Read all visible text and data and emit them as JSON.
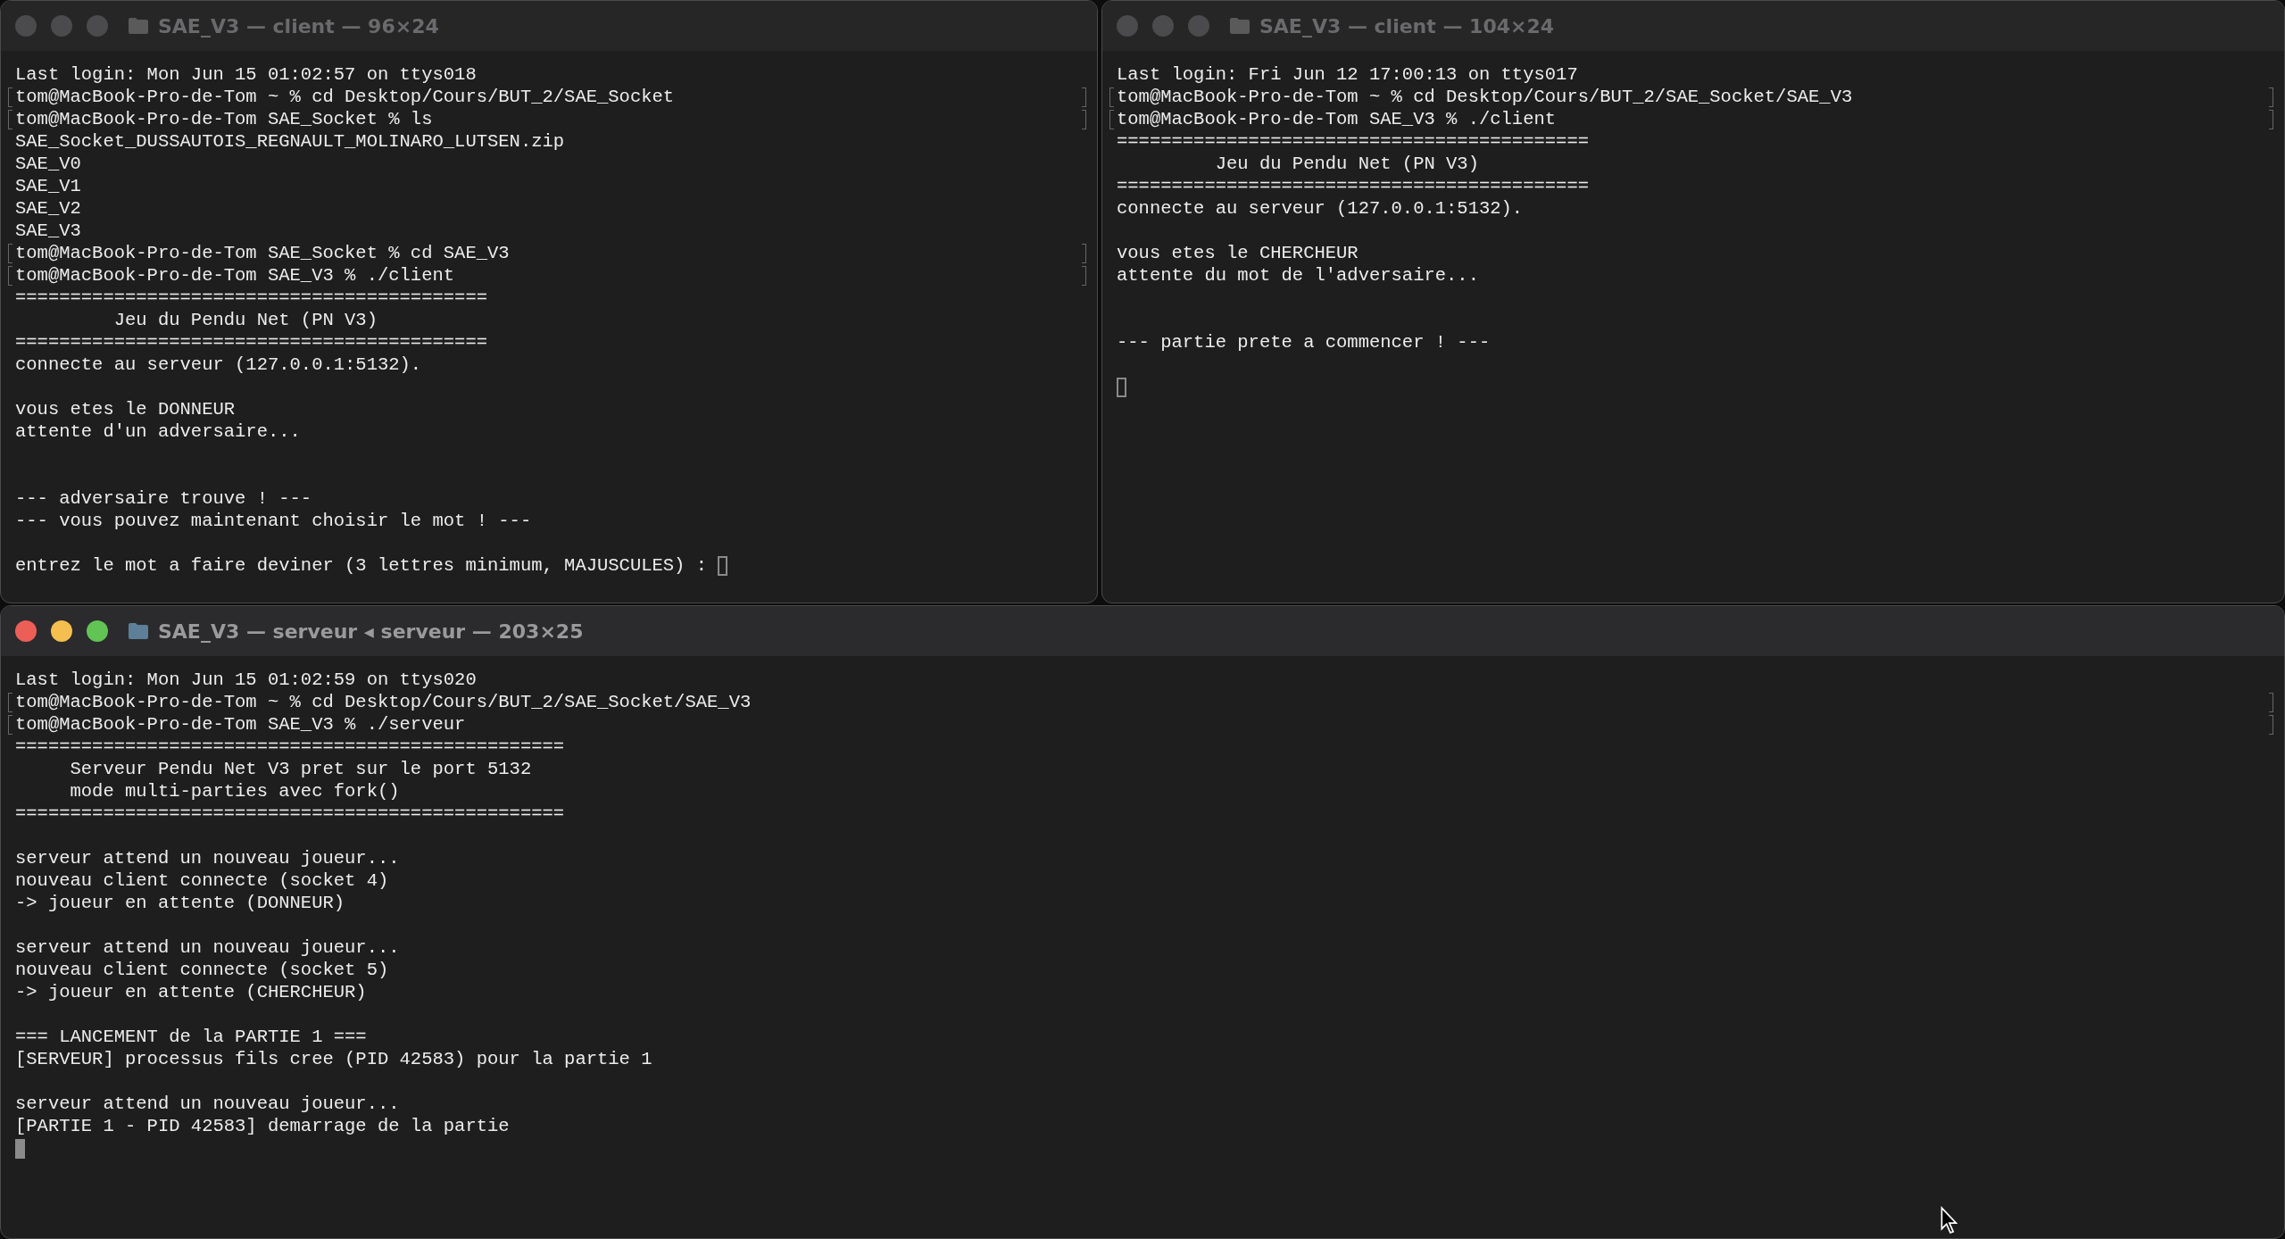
{
  "windows": [
    {
      "title": "SAE_V3 — client — 96×24",
      "focused": false,
      "lines": [
        {
          "kind": "output",
          "text": "Last login: Mon Jun 15 01:02:57 on ttys018"
        },
        {
          "kind": "command",
          "text": "tom@MacBook-Pro-de-Tom ~ % cd Desktop/Cours/BUT_2/SAE_Socket"
        },
        {
          "kind": "command",
          "text": "tom@MacBook-Pro-de-Tom SAE_Socket % ls"
        },
        {
          "kind": "output",
          "text": "SAE_Socket_DUSSAUTOIS_REGNAULT_MOLINARO_LUTSEN.zip"
        },
        {
          "kind": "output",
          "text": "SAE_V0"
        },
        {
          "kind": "output",
          "text": "SAE_V1"
        },
        {
          "kind": "output",
          "text": "SAE_V2"
        },
        {
          "kind": "output",
          "text": "SAE_V3"
        },
        {
          "kind": "command",
          "text": "tom@MacBook-Pro-de-Tom SAE_Socket % cd SAE_V3"
        },
        {
          "kind": "command",
          "text": "tom@MacBook-Pro-de-Tom SAE_V3 % ./client"
        },
        {
          "kind": "output",
          "text": "==========================================="
        },
        {
          "kind": "output",
          "text": "         Jeu du Pendu Net (PN V3)"
        },
        {
          "kind": "output",
          "text": "==========================================="
        },
        {
          "kind": "output",
          "text": "connecte au serveur (127.0.0.1:5132)."
        },
        {
          "kind": "blank"
        },
        {
          "kind": "output",
          "text": "vous etes le DONNEUR"
        },
        {
          "kind": "output",
          "text": "attente d'un adversaire..."
        },
        {
          "kind": "blank"
        },
        {
          "kind": "blank"
        },
        {
          "kind": "output",
          "text": "--- adversaire trouve ! ---"
        },
        {
          "kind": "output",
          "text": "--- vous pouvez maintenant choisir le mot ! ---"
        },
        {
          "kind": "blank"
        },
        {
          "kind": "input",
          "text": "entrez le mot a faire deviner (3 lettres minimum, MAJUSCULES) : ",
          "cursor_filled": false
        }
      ]
    },
    {
      "title": "SAE_V3 — client — 104×24",
      "focused": false,
      "lines": [
        {
          "kind": "output",
          "text": "Last login: Fri Jun 12 17:00:13 on ttys017"
        },
        {
          "kind": "command",
          "text": "tom@MacBook-Pro-de-Tom ~ % cd Desktop/Cours/BUT_2/SAE_Socket/SAE_V3"
        },
        {
          "kind": "command",
          "text": "tom@MacBook-Pro-de-Tom SAE_V3 % ./client"
        },
        {
          "kind": "output",
          "text": "==========================================="
        },
        {
          "kind": "output",
          "text": "         Jeu du Pendu Net (PN V3)"
        },
        {
          "kind": "output",
          "text": "==========================================="
        },
        {
          "kind": "output",
          "text": "connecte au serveur (127.0.0.1:5132)."
        },
        {
          "kind": "blank"
        },
        {
          "kind": "output",
          "text": "vous etes le CHERCHEUR"
        },
        {
          "kind": "output",
          "text": "attente du mot de l'adversaire..."
        },
        {
          "kind": "blank"
        },
        {
          "kind": "blank"
        },
        {
          "kind": "output",
          "text": "--- partie prete a commencer ! ---"
        },
        {
          "kind": "blank"
        },
        {
          "kind": "input",
          "cursor_filled": false
        }
      ]
    },
    {
      "title": "SAE_V3 — serveur ◂ serveur — 203×25",
      "focused": true,
      "lines": [
        {
          "kind": "output",
          "text": "Last login: Mon Jun 15 01:02:59 on ttys020"
        },
        {
          "kind": "command",
          "text": "tom@MacBook-Pro-de-Tom ~ % cd Desktop/Cours/BUT_2/SAE_Socket/SAE_V3"
        },
        {
          "kind": "command",
          "text": "tom@MacBook-Pro-de-Tom SAE_V3 % ./serveur"
        },
        {
          "kind": "output",
          "text": "=================================================="
        },
        {
          "kind": "output",
          "text": "     Serveur Pendu Net V3 pret sur le port 5132"
        },
        {
          "kind": "output",
          "text": "     mode multi-parties avec fork()"
        },
        {
          "kind": "output",
          "text": "=================================================="
        },
        {
          "kind": "blank"
        },
        {
          "kind": "output",
          "text": "serveur attend un nouveau joueur..."
        },
        {
          "kind": "output",
          "text": "nouveau client connecte (socket 4)"
        },
        {
          "kind": "output",
          "text": "-> joueur en attente (DONNEUR)"
        },
        {
          "kind": "blank"
        },
        {
          "kind": "output",
          "text": "serveur attend un nouveau joueur..."
        },
        {
          "kind": "output",
          "text": "nouveau client connecte (socket 5)"
        },
        {
          "kind": "output",
          "text": "-> joueur en attente (CHERCHEUR)"
        },
        {
          "kind": "blank"
        },
        {
          "kind": "output",
          "text": "=== LANCEMENT de la PARTIE 1 ==="
        },
        {
          "kind": "output",
          "text": "[SERVEUR] processus fils cree (PID 42583) pour la partie 1"
        },
        {
          "kind": "blank"
        },
        {
          "kind": "output",
          "text": "serveur attend un nouveau joueur..."
        },
        {
          "kind": "output",
          "text": "[PARTIE 1 - PID 42583] demarrage de la partie"
        },
        {
          "kind": "input",
          "cursor_filled": true
        }
      ]
    }
  ]
}
